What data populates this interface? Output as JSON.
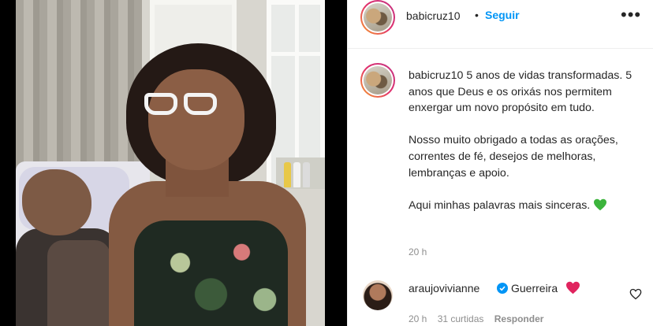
{
  "header": {
    "username": "babicruz10",
    "separator": "•",
    "follow_label": "Seguir",
    "more_label": "•••"
  },
  "caption": {
    "username": "babicruz10",
    "paragraph1": "5 anos de vidas transformadas. 5 anos que Deus e os orixás nos permitem enxergar um novo propósito em tudo.",
    "paragraph2": "Nosso muito obrigado a todas as orações, correntes de fé, desejos de melhoras, lembranças e apoio.",
    "paragraph3": "Aqui minhas palavras mais sinceras.",
    "time": "20 h"
  },
  "comment": {
    "username": "araujovivianne",
    "text": "Guerreira",
    "time": "20 h",
    "likes": "31 curtidas",
    "reply_label": "Responder"
  },
  "icons": {
    "post_emoji": "green-heart-icon",
    "comment_emoji": "red-heart-icon",
    "verified": "verified-badge-icon",
    "like": "heart-outline-icon"
  },
  "colors": {
    "follow": "#0095f6",
    "muted": "#8e8e8e",
    "text": "#262626",
    "green_heart": "#3cb43c",
    "red_heart": "#e0245e"
  }
}
